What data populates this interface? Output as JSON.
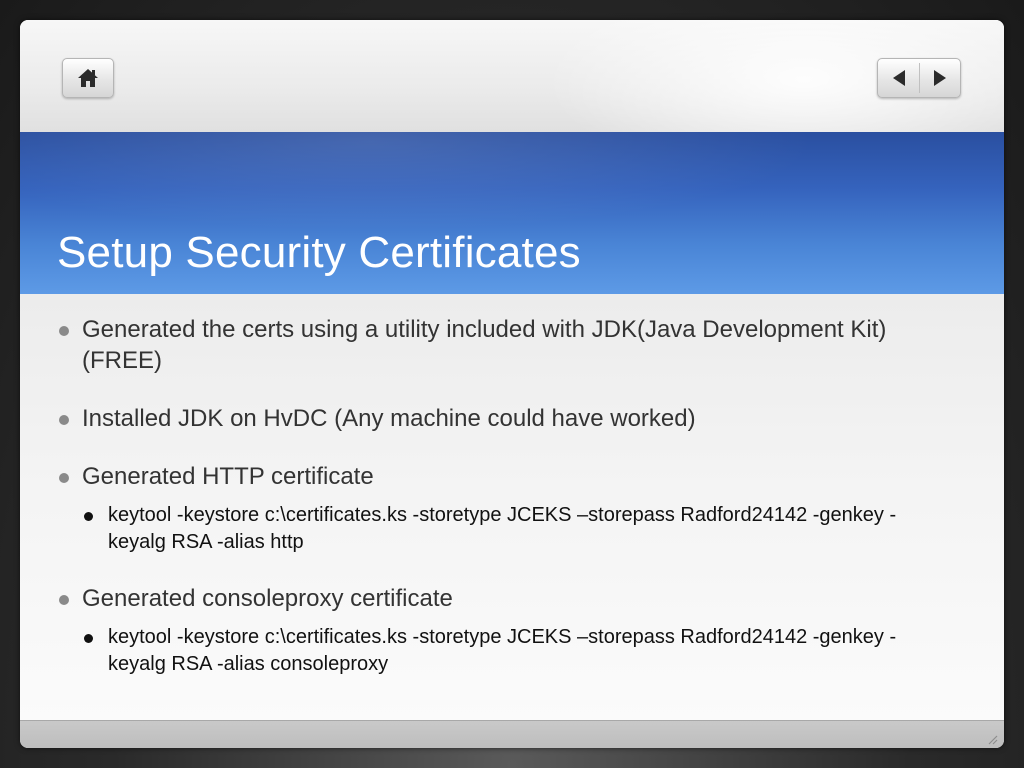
{
  "slide": {
    "title": "Setup Security Certificates",
    "bullets": [
      {
        "text": "Generated the certs using a utility included with JDK(Java Development Kit)(FREE)",
        "sub": []
      },
      {
        "text": "Installed JDK on HvDC (Any machine could have worked)",
        "sub": []
      },
      {
        "text": "Generated HTTP certificate",
        "sub": [
          "keytool -keystore c:\\certificates.ks -storetype JCEKS –storepass Radford24142 -genkey -keyalg RSA -alias http"
        ]
      },
      {
        "text": "Generated consoleproxy certificate",
        "sub": [
          "keytool -keystore c:\\certificates.ks -storetype JCEKS –storepass Radford24142 -genkey -keyalg RSA -alias consoleproxy"
        ]
      }
    ]
  },
  "nav": {
    "home_icon": "home-icon",
    "prev_icon": "arrow-left-icon",
    "next_icon": "arrow-right-icon"
  },
  "colors": {
    "title_band_top": "#2a4fa0",
    "title_band_bottom": "#5d9ae6",
    "title_text": "#ffffff",
    "body_text": "#333333"
  }
}
